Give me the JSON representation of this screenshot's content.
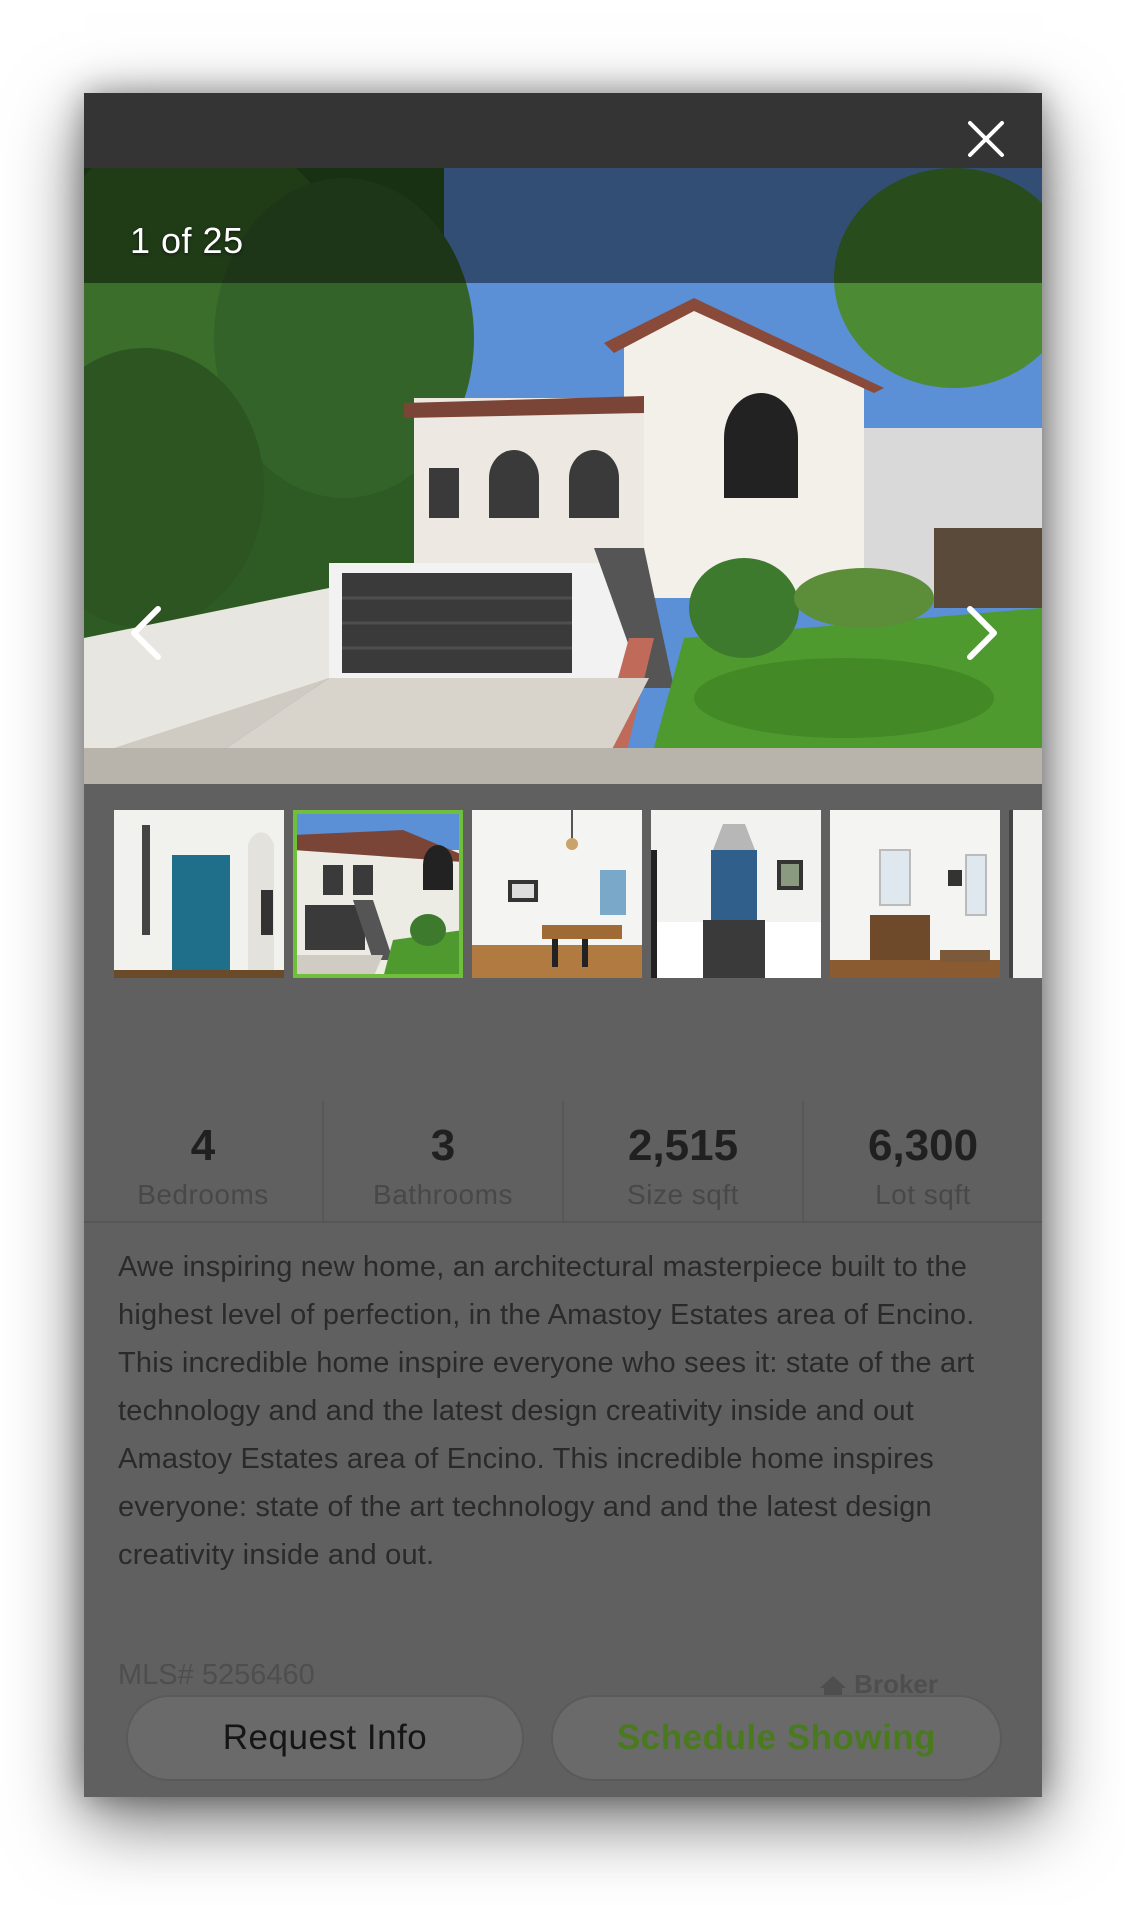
{
  "gallery": {
    "counter": "1 of 25",
    "close_label": "close",
    "prev_icon": "chevron-left-icon",
    "next_icon": "chevron-right-icon",
    "selected_thumb_color": "#6fbf3d"
  },
  "stats": [
    {
      "value": "4",
      "label": "Bedrooms"
    },
    {
      "value": "3",
      "label": "Bathrooms"
    },
    {
      "value": "2,515",
      "label": "Size sqft"
    },
    {
      "value": "6,300",
      "label": "Lot sqft"
    }
  ],
  "description": "Awe inspiring new home, an architectural masterpiece built to the highest level of perfection, in the Amastoy Estates area of Encino. This incredible home inspire everyone who sees it: state of the art technology and and the latest design creativity inside and out Amastoy Estates area of Encino. This incredible home inspires everyone: state of the art technology and and the latest design creativity inside and out.",
  "listing": {
    "mls": "MLS# 5256460",
    "broker_label": "Broker"
  },
  "actions": {
    "request_info": "Request Info",
    "schedule_showing": "Schedule Showing"
  },
  "colors": {
    "accent_green": "#4a7a1e"
  }
}
